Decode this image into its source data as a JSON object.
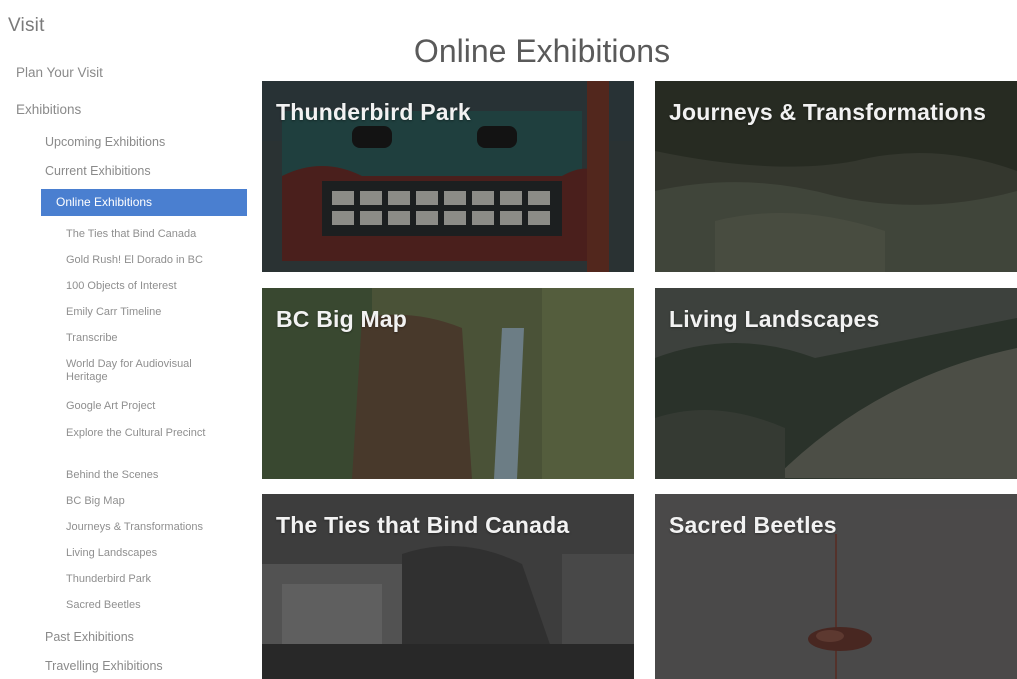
{
  "sidebar": {
    "heading": "Visit",
    "plan_visit": "Plan Your Visit",
    "exhibitions": "Exhibitions",
    "upcoming": "Upcoming Exhibitions",
    "current": "Current Exhibitions",
    "online": "Online Exhibitions",
    "sub_items": [
      "The Ties that Bind Canada",
      "Gold Rush! El Dorado in BC",
      "100 Objects of Interest",
      "Emily Carr Timeline",
      "Transcribe",
      "World Day for Audiovisual Heritage",
      "Google Art Project",
      "Explore the Cultural Precinct",
      "Behind the Scenes",
      "BC Big Map",
      "Journeys & Transformations",
      "Living Landscapes",
      "Thunderbird Park",
      "Sacred Beetles"
    ],
    "past": "Past Exhibitions",
    "travelling": "Travelling Exhibitions"
  },
  "main": {
    "title": "Online Exhibitions",
    "tiles": [
      {
        "label": "Thunderbird Park",
        "icon": "totem-image"
      },
      {
        "label": "Journeys & Transformations",
        "icon": "forest-image"
      },
      {
        "label": "BC Big Map",
        "icon": "map-image"
      },
      {
        "label": "Living Landscapes",
        "icon": "mountain-image"
      },
      {
        "label": "The Ties that Bind Canada",
        "icon": "historic-photo-image"
      },
      {
        "label": "Sacred Beetles",
        "icon": "beetle-image"
      }
    ]
  },
  "colors": {
    "active_nav": "#4a7fd0",
    "tile_text": "#f2f2f2"
  }
}
